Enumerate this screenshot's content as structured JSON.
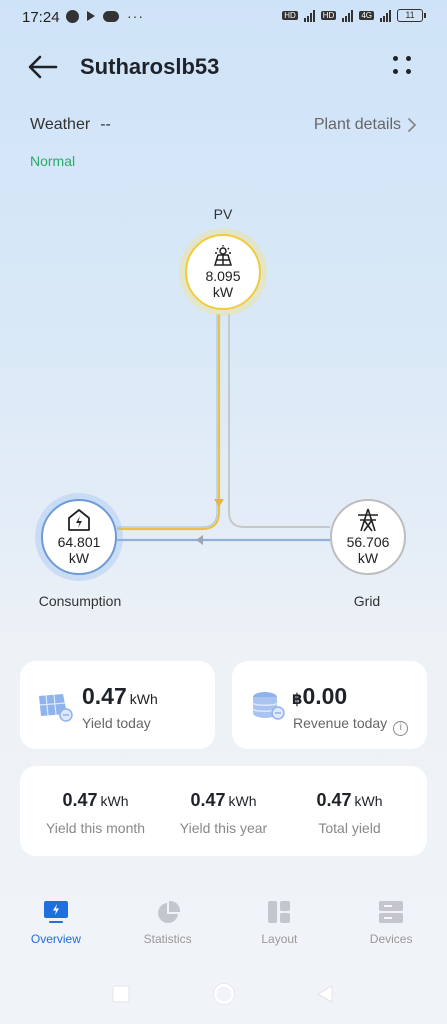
{
  "status_bar": {
    "time": "17:24",
    "battery": "11",
    "network": "4G"
  },
  "header": {
    "title": "Sutharoslb53"
  },
  "weather": {
    "label": "Weather",
    "value": "--"
  },
  "plant_details_label": "Plant details",
  "status_text": "Normal",
  "flow": {
    "pv": {
      "label": "PV",
      "value": "8.095",
      "unit": "kW"
    },
    "consumption": {
      "label": "Consumption",
      "value": "64.801",
      "unit": "kW"
    },
    "grid": {
      "label": "Grid",
      "value": "56.706",
      "unit": "kW"
    }
  },
  "yield_today": {
    "value": "0.47",
    "unit": "kWh",
    "label": "Yield today"
  },
  "revenue_today": {
    "currency": "฿",
    "value": "0.00",
    "label": "Revenue today"
  },
  "summary": [
    {
      "value": "0.47",
      "unit": "kWh",
      "label": "Yield this month"
    },
    {
      "value": "0.47",
      "unit": "kWh",
      "label": "Yield this year"
    },
    {
      "value": "0.47",
      "unit": "kWh",
      "label": "Total yield"
    }
  ],
  "nav": [
    {
      "label": "Overview",
      "icon": "overview-icon",
      "active": true
    },
    {
      "label": "Statistics",
      "icon": "pie-chart-icon",
      "active": false
    },
    {
      "label": "Layout",
      "icon": "layout-icon",
      "active": false
    },
    {
      "label": "Devices",
      "icon": "devices-icon",
      "active": false
    }
  ],
  "colors": {
    "accent": "#1f6fe0",
    "pv_ring": "#f1cc3a",
    "consumption_ring": "#6e9bd8",
    "normal_status": "#2aaa6a"
  }
}
